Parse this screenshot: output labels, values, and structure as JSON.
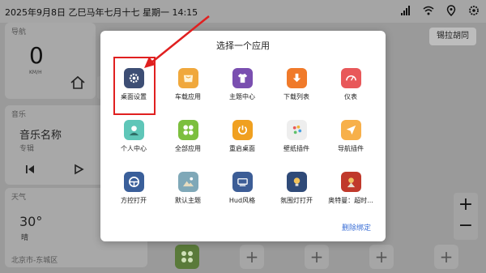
{
  "statusbar": {
    "datetime": "2025年9月8日  乙巳马年七月十七  星期一  14:15"
  },
  "background": {
    "nav_title": "导航",
    "speed": "0",
    "speed_unit": "KM/H",
    "music_title": "音乐",
    "song_name": "音乐名称",
    "artist": "专辑",
    "weather_title": "天气",
    "temperature": "30°",
    "condition": "晴",
    "location": "北京市-东城区",
    "right_button": "锡拉胡同",
    "zoom_in": "+",
    "zoom_out": "−",
    "dock_plus": "+"
  },
  "dialog": {
    "title": "选择一个应用",
    "unbind_label": "删除绑定",
    "apps": [
      {
        "label": "桌面设置",
        "icon": "gear-icon",
        "color": "#3d4e74"
      },
      {
        "label": "车载应用",
        "icon": "store-icon",
        "color": "#f0a83c"
      },
      {
        "label": "主题中心",
        "icon": "tshirt-icon",
        "color": "#7a4fb0"
      },
      {
        "label": "下载列表",
        "icon": "download-icon",
        "color": "#f07a2a"
      },
      {
        "label": "仪表",
        "icon": "gauge-icon",
        "color": "#e8585a"
      },
      {
        "label": "个人中心",
        "icon": "person-icon",
        "color": "#5fc6b8"
      },
      {
        "label": "全部应用",
        "icon": "apps-grid-icon",
        "color": "#7cbf3e"
      },
      {
        "label": "重启桌面",
        "icon": "power-icon",
        "color": "#f0a020"
      },
      {
        "label": "壁纸插件",
        "icon": "palette-icon",
        "color": "#eeeeee"
      },
      {
        "label": "导航插件",
        "icon": "navigation-icon",
        "color": "#f7b04a"
      },
      {
        "label": "方控打开",
        "icon": "steering-wheel-icon",
        "color": "#3a5f9a"
      },
      {
        "label": "默认主题",
        "icon": "landscape-icon",
        "color": "#7fa8b8"
      },
      {
        "label": "Hud风格",
        "icon": "hud-icon",
        "color": "#3c5d96"
      },
      {
        "label": "氛围灯打开",
        "icon": "lightbulb-icon",
        "color": "#2f4a78"
      },
      {
        "label": "奥特曼：超时...",
        "icon": "ultraman-game-icon",
        "color": "#c0392b"
      }
    ]
  },
  "colors": {
    "highlight": "#e02020",
    "link": "#3b6fd6"
  }
}
